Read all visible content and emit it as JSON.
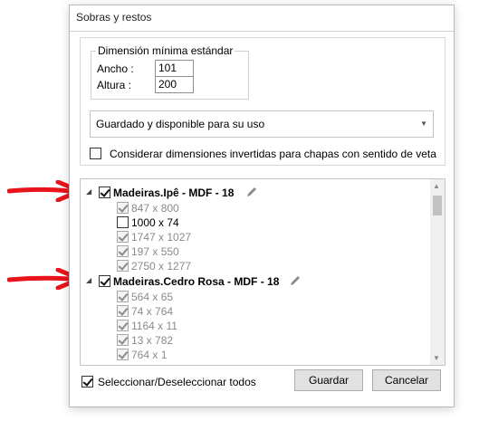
{
  "dialog": {
    "title": "Sobras y restos"
  },
  "dimension": {
    "legend": "Dimensión mínima estándar",
    "width_label": "Ancho :",
    "width_value": "101",
    "height_label": "Altura :",
    "height_value": "200"
  },
  "filter": {
    "selected": "Guardado y disponible para su uso"
  },
  "invert": {
    "label": "Considerar dimensiones invertidas para chapas con sentido de veta",
    "checked": false
  },
  "tree": {
    "groups": [
      {
        "label": "Madeiras.Ipê - MDF - 18",
        "checked": true,
        "expanded": true,
        "children": [
          {
            "label": "847 x 800",
            "checked": true,
            "disabled": true
          },
          {
            "label": "1000 x 74",
            "checked": false,
            "disabled": false
          },
          {
            "label": "1747 x 1027",
            "checked": true,
            "disabled": true
          },
          {
            "label": "197 x 550",
            "checked": true,
            "disabled": true
          },
          {
            "label": "2750 x 1277",
            "checked": true,
            "disabled": true
          }
        ]
      },
      {
        "label": "Madeiras.Cedro Rosa - MDF - 18",
        "checked": true,
        "expanded": true,
        "children": [
          {
            "label": "564 x 65",
            "checked": true,
            "disabled": true
          },
          {
            "label": "74 x 764",
            "checked": true,
            "disabled": true
          },
          {
            "label": "1164 x 11",
            "checked": true,
            "disabled": true
          },
          {
            "label": "13 x 782",
            "checked": true,
            "disabled": true
          },
          {
            "label": "764 x 1",
            "checked": true,
            "disabled": true
          }
        ]
      }
    ]
  },
  "footer": {
    "select_all_label": "Seleccionar/Deseleccionar todos",
    "select_all_checked": true,
    "save_label": "Guardar",
    "cancel_label": "Cancelar"
  },
  "colors": {
    "arrow": "#e8131b"
  }
}
